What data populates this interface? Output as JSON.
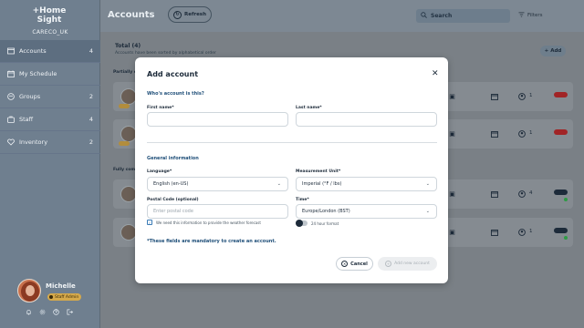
{
  "app": {
    "logo_line1": "+Home",
    "logo_line2": "Sight",
    "org": "CARECO_UK"
  },
  "sidebar": {
    "items": [
      {
        "label": "Accounts",
        "count": "4",
        "icon": "accounts-icon"
      },
      {
        "label": "My Schedule",
        "count": "",
        "icon": "calendar-icon"
      },
      {
        "label": "Groups",
        "count": "2",
        "icon": "groups-icon"
      },
      {
        "label": "Staff",
        "count": "4",
        "icon": "staff-icon"
      },
      {
        "label": "Inventory",
        "count": "2",
        "icon": "heart-icon"
      }
    ],
    "profile": {
      "name": "Michelle",
      "role": "Staff Admin"
    }
  },
  "header": {
    "title": "Accounts",
    "refresh_label": "Refresh",
    "search_label": "Search",
    "filters_label": "Filters"
  },
  "content": {
    "total": "Total (4)",
    "sorted_note": "Accounts have been sorted by alphabetical order",
    "add_label": "Add",
    "section1": "Partially c",
    "section2": "Fully comp",
    "rows": [
      {
        "count": "1",
        "toggle_color": "#a12426"
      },
      {
        "count": "1",
        "toggle_color": "#a12426"
      },
      {
        "count": "4",
        "toggle_color": "#1d2b3a"
      },
      {
        "count": "1",
        "toggle_color": "#1d2b3a"
      }
    ]
  },
  "modal": {
    "title": "Add account",
    "close_icon": "close-icon",
    "subtitle": "Who's account is this?",
    "first_name_label": "First name*",
    "first_name_value": "",
    "last_name_label": "Last name*",
    "last_name_value": "",
    "general_info": "General information",
    "language_label": "Language*",
    "language_value": "English (en-US)",
    "measurement_label": "Measurement Unit*",
    "measurement_value": "Imperial (°F / lbs)",
    "postal_label": "Postal Code (optional)",
    "postal_placeholder": "Enter postal code",
    "time_label": "Time*",
    "time_value": "Europe/London (BST)",
    "weather_hint": "We need this information to provide the weather forecast",
    "hour_format": "24 hour format",
    "mandatory_note": "*These fields are mandatory to create an account.",
    "cancel_label": "Cancel",
    "add_new_label": "Add new account"
  }
}
